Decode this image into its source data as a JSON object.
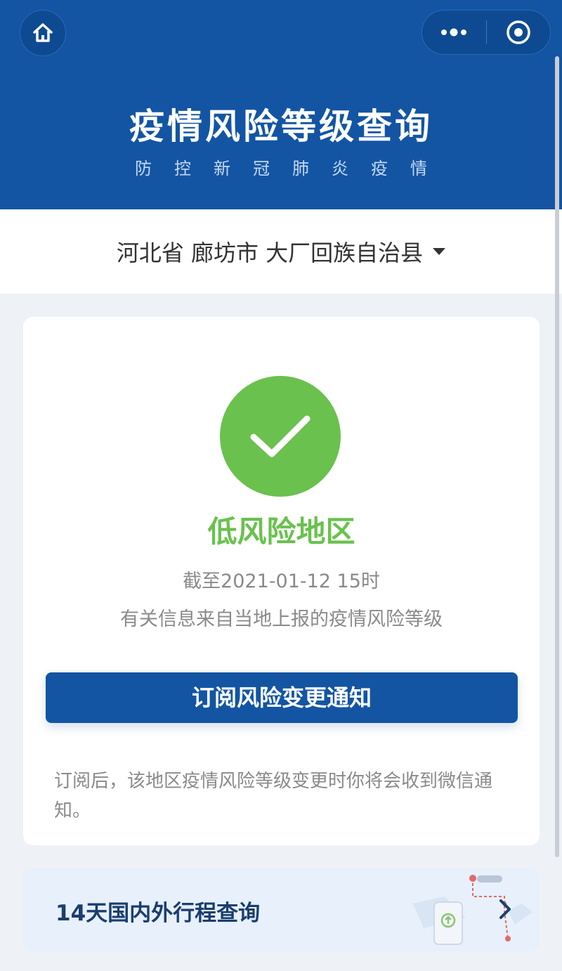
{
  "header": {
    "title": "疫情风险等级查询",
    "subtitle": "防控新冠肺炎疫情",
    "home_icon": "home-icon",
    "more_icon": "more-dots-icon",
    "close_icon": "target-close-icon",
    "color": "#1355a3"
  },
  "region": {
    "selected": "河北省 廊坊市 大厂回族自治县"
  },
  "status": {
    "level": "低风险地区",
    "as_of": "截至2021-01-12 15时",
    "source": "有关信息来自当地上报的疫情风险等级",
    "color": "#6ac14e"
  },
  "subscribe": {
    "label": "订阅风险变更通知",
    "note": "订阅后，该地区疫情风险等级变更时你将会收到微信通知。"
  },
  "trip": {
    "label": "14天国内外行程查询"
  }
}
